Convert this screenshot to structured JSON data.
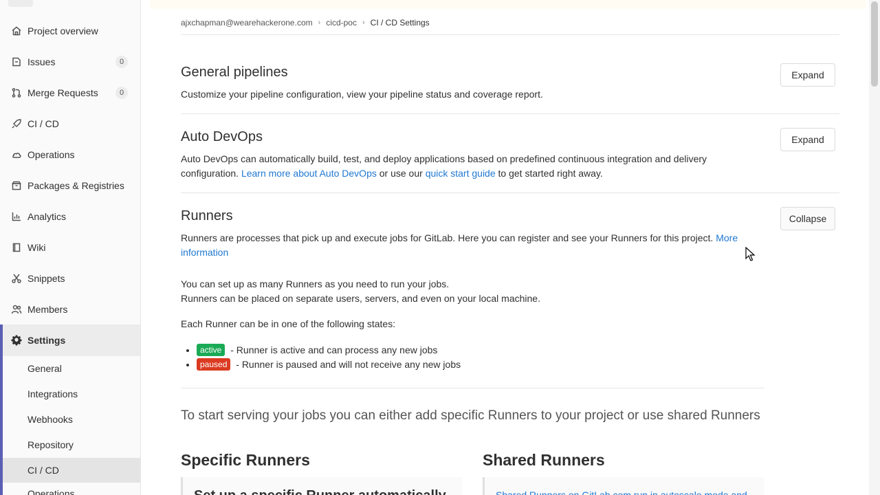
{
  "sidebar": {
    "items": [
      {
        "label": "Project overview",
        "icon": "home-icon"
      },
      {
        "label": "Issues",
        "icon": "issues-icon",
        "count": "0"
      },
      {
        "label": "Merge Requests",
        "icon": "merge-request-icon",
        "count": "0"
      },
      {
        "label": "CI / CD",
        "icon": "rocket-icon"
      },
      {
        "label": "Operations",
        "icon": "cloud-gear-icon"
      },
      {
        "label": "Packages & Registries",
        "icon": "package-icon"
      },
      {
        "label": "Analytics",
        "icon": "chart-icon"
      },
      {
        "label": "Wiki",
        "icon": "book-icon"
      },
      {
        "label": "Snippets",
        "icon": "scissors-icon"
      },
      {
        "label": "Members",
        "icon": "users-icon"
      },
      {
        "label": "Settings",
        "icon": "gear-icon"
      }
    ],
    "settings_sub": [
      "General",
      "Integrations",
      "Webhooks",
      "Repository",
      "CI / CD",
      "Operations"
    ]
  },
  "breadcrumb": {
    "items": [
      "ajxchapman@wearehackerone.com",
      "cicd-poc",
      "CI / CD Settings"
    ]
  },
  "sections": {
    "general": {
      "title": "General pipelines",
      "desc": "Customize your pipeline configuration, view your pipeline status and coverage report.",
      "button": "Expand"
    },
    "autodevops": {
      "title": "Auto DevOps",
      "desc1": "Auto DevOps can automatically build, test, and deploy applications based on predefined continuous integration and delivery",
      "desc2_a": "configuration. ",
      "link1": "Learn more about Auto DevOps",
      "desc2_b": " or use our ",
      "link2": "quick start guide",
      "desc2_c": " to get started right away.",
      "button": "Expand"
    },
    "runners": {
      "title": "Runners",
      "desc": "Runners are processes that pick up and execute jobs for GitLab. Here you can register and see your Runners for this project. ",
      "more_link_1": "More",
      "more_link_2": "information",
      "button": "Collapse",
      "para1": "You can set up as many Runners as you need to run your jobs.",
      "para2": "Runners can be placed on separate users, servers, and even on your local machine.",
      "states_intro": "Each Runner can be in one of the following states:",
      "states": [
        {
          "pill": "active",
          "text": " - Runner is active and can process any new jobs",
          "color": "#1aaa55"
        },
        {
          "pill": "paused",
          "text": " - Runner is paused and will not receive any new jobs",
          "color": "#db3b21"
        }
      ],
      "serve_text": "To start serving your jobs you can either add specific Runners to your project or use shared Runners",
      "specific_title": "Specific Runners",
      "shared_title": "Shared Runners",
      "specific_panel": "Set up a specific Runner automatically",
      "shared_panel": "Shared Runners on GitLab.com run in autoscale mode and"
    }
  },
  "colors": {
    "accent": "#1f78d1",
    "settings_bar": "#5a5fb5"
  }
}
